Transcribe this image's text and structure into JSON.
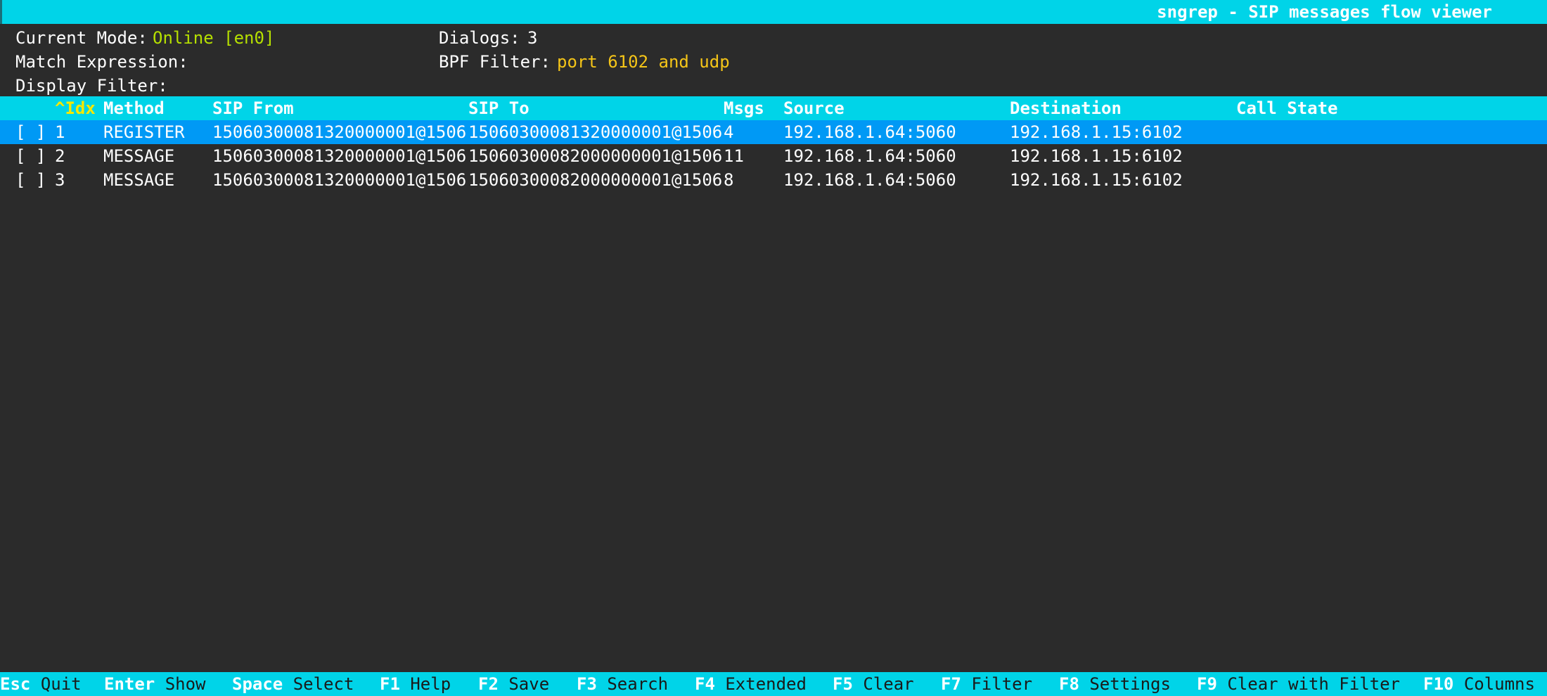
{
  "app": {
    "title": "sngrep - SIP messages flow viewer"
  },
  "status": {
    "mode_label": "Current Mode:",
    "mode_value": "Online [en0]",
    "dialogs_label": "Dialogs:",
    "dialogs_value": "3",
    "match_label": "Match Expression:",
    "bpf_label": "BPF Filter:",
    "bpf_value": "port 6102 and udp",
    "display_filter_label": "Display Filter:"
  },
  "table": {
    "columns": {
      "idx": "^Idx",
      "method": "Method",
      "from": "SIP From",
      "to": "SIP To",
      "msgs": "Msgs",
      "source": "Source",
      "destination": "Destination",
      "state": "Call State"
    },
    "rows": [
      {
        "check": "[ ]",
        "idx": "1",
        "method": "REGISTER",
        "from": "15060300081320000001@1506",
        "to": "15060300081320000001@1506",
        "msgs": "4",
        "source": "192.168.1.64:5060",
        "destination": "192.168.1.15:6102",
        "state": ""
      },
      {
        "check": "[ ]",
        "idx": "2",
        "method": "MESSAGE",
        "from": "15060300081320000001@1506",
        "to": "15060300082000000001@1506",
        "msgs": "11",
        "source": "192.168.1.64:5060",
        "destination": "192.168.1.15:6102",
        "state": ""
      },
      {
        "check": "[ ]",
        "idx": "3",
        "method": "MESSAGE",
        "from": "15060300081320000001@1506",
        "to": "15060300082000000001@1506",
        "msgs": "8",
        "source": "192.168.1.64:5060",
        "destination": "192.168.1.15:6102",
        "state": ""
      }
    ]
  },
  "footer": {
    "items": [
      {
        "key": "Esc",
        "action": "Quit"
      },
      {
        "key": "Enter",
        "action": "Show"
      },
      {
        "key": "Space",
        "action": "Select"
      },
      {
        "key": "F1",
        "action": "Help"
      },
      {
        "key": "F2",
        "action": "Save"
      },
      {
        "key": "F3",
        "action": "Search"
      },
      {
        "key": "F4",
        "action": "Extended"
      },
      {
        "key": "F5",
        "action": "Clear"
      },
      {
        "key": "F7",
        "action": "Filter"
      },
      {
        "key": "F8",
        "action": "Settings"
      },
      {
        "key": "F9",
        "action": "Clear with Filter"
      },
      {
        "key": "F10",
        "action": "Columns"
      }
    ]
  },
  "colors": {
    "bar": "#00d4e8",
    "selected_row": "#0099f5",
    "background": "#2b2b2b",
    "mode_value": "#b6e000",
    "bpf_value": "#f5c518",
    "sorted_column": "#f5e800"
  }
}
